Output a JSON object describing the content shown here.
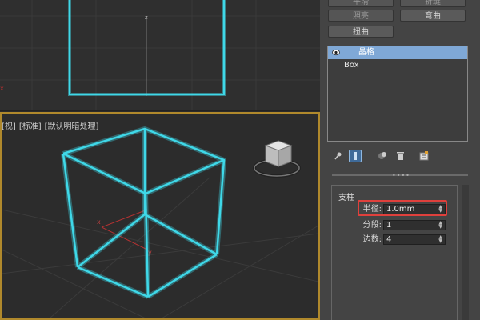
{
  "viewport_persp": {
    "labels": [
      "[视]",
      "[标准]",
      "[默认明暗处理]"
    ]
  },
  "panel": {
    "ribbon": {
      "row1_left": "平滑",
      "row1_right": "折缝",
      "row2_left": "照亮",
      "row2_right": "弯曲",
      "row3_left": "扭曲"
    },
    "modifier_stack": [
      {
        "label": "晶格",
        "selected": true
      },
      {
        "label": "Box",
        "selected": false
      }
    ],
    "rollout": {
      "title": "支柱",
      "params": [
        {
          "label": "半径:",
          "value": "1.0mm"
        },
        {
          "label": "分段:",
          "value": "1"
        },
        {
          "label": "边数:",
          "value": "4"
        }
      ]
    }
  },
  "colors": {
    "selection_wire": "#3fd8e8",
    "active_viewport_border": "#b0892c",
    "highlight_box": "#e0403c",
    "stack_selected": "#7fa8d6"
  }
}
